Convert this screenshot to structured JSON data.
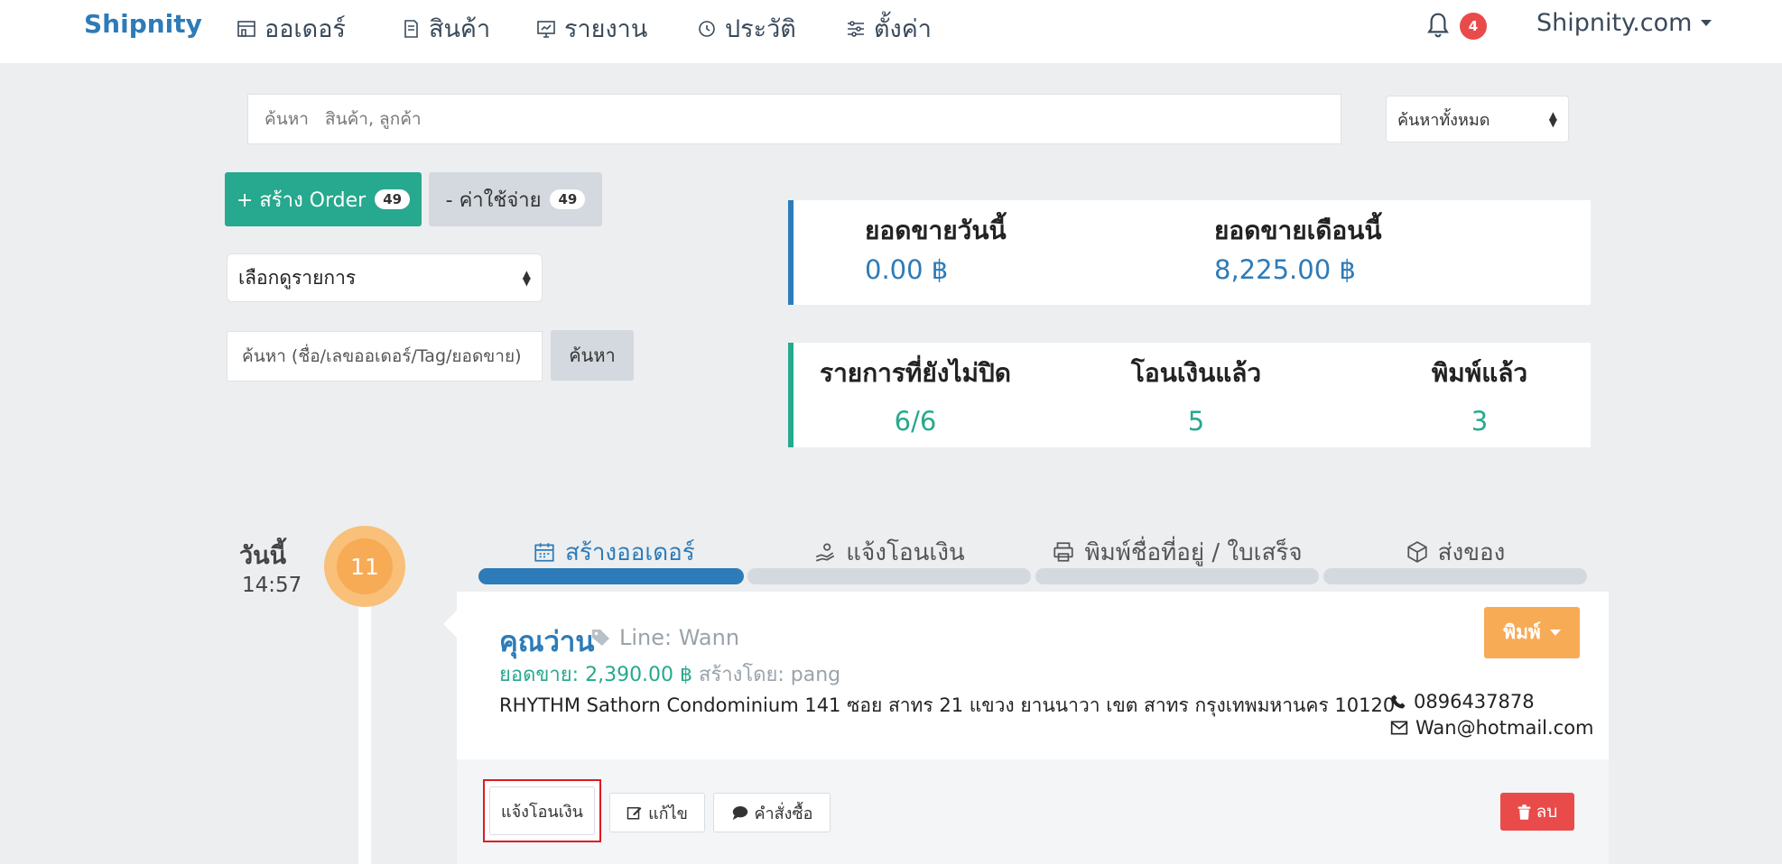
{
  "nav": {
    "brand": "Shipnity",
    "items": [
      {
        "label": "ออเดอร์",
        "icon": "store-icon"
      },
      {
        "label": "สินค้า",
        "icon": "box-icon"
      },
      {
        "label": "รายงาน",
        "icon": "monitor-icon"
      },
      {
        "label": "ประวัติ",
        "icon": "history-icon"
      },
      {
        "label": "ตั้งค่า",
        "icon": "sliders-icon"
      }
    ],
    "notification_count": "4",
    "account": "Shipnity.com"
  },
  "search": {
    "placeholder": "ค้นหา   สินค้า, ลูกค้า",
    "scope": "ค้นหาทั้งหมด"
  },
  "actions": {
    "create_label": "+ สร้าง Order",
    "create_count": "49",
    "expense_label": "- ค่าใช้จ่าย",
    "expense_count": "49"
  },
  "filter": {
    "view_select": "เลือกดูรายการ",
    "order_search_placeholder": "ค้นหา (ชื่อ/เลขออเดอร์/Tag/ยอดขาย)",
    "search_button": "ค้นหา"
  },
  "sales": {
    "today_label": "ยอดขายวันนี้",
    "today_value": "0.00 ฿",
    "month_label": "ยอดขายเดือนนี้",
    "month_value": "8,225.00 ฿"
  },
  "status": {
    "open_label": "รายการที่ยังไม่ปิด",
    "open_value": "6/6",
    "paid_label": "โอนเงินแล้ว",
    "paid_value": "5",
    "printed_label": "พิมพ์แล้ว",
    "printed_value": "3"
  },
  "timeline": {
    "day_label": "วันนี้",
    "time": "14:57",
    "day_number": "11"
  },
  "steps": [
    {
      "label": "สร้างออเดอร์",
      "icon": "calendar-icon",
      "active": true
    },
    {
      "label": "แจ้งโอนเงิน",
      "icon": "hand-money-icon",
      "active": false
    },
    {
      "label": "พิมพ์ชื่อที่อยู่ / ใบเสร็จ",
      "icon": "printer-icon",
      "active": false
    },
    {
      "label": "ส่งของ",
      "icon": "package-icon",
      "active": false
    }
  ],
  "order": {
    "customer_name": "คุณว่าน",
    "tag": "Line: Wann",
    "sale_label": "ยอดขาย: 2,390.00 ฿",
    "created_by": "สร้างโดย: pang",
    "address": "RHYTHM Sathorn Condominium 141 ซอย สาทร 21 แขวง ยานนาวา เขต สาทร กรุงเทพมหานคร 10120",
    "phone": "0896437878",
    "email": "Wan@hotmail.com",
    "print_label": "พิมพ์",
    "buttons": {
      "notify": "แจ้งโอนเงิน",
      "edit": "แก้ไข",
      "purchase": "คำสั่งซื้อ",
      "delete": "ลบ"
    }
  },
  "colors": {
    "brand_blue": "#2d7bb8",
    "teal": "#26a98e",
    "orange": "#f7ab55",
    "danger": "#e94b4b"
  }
}
